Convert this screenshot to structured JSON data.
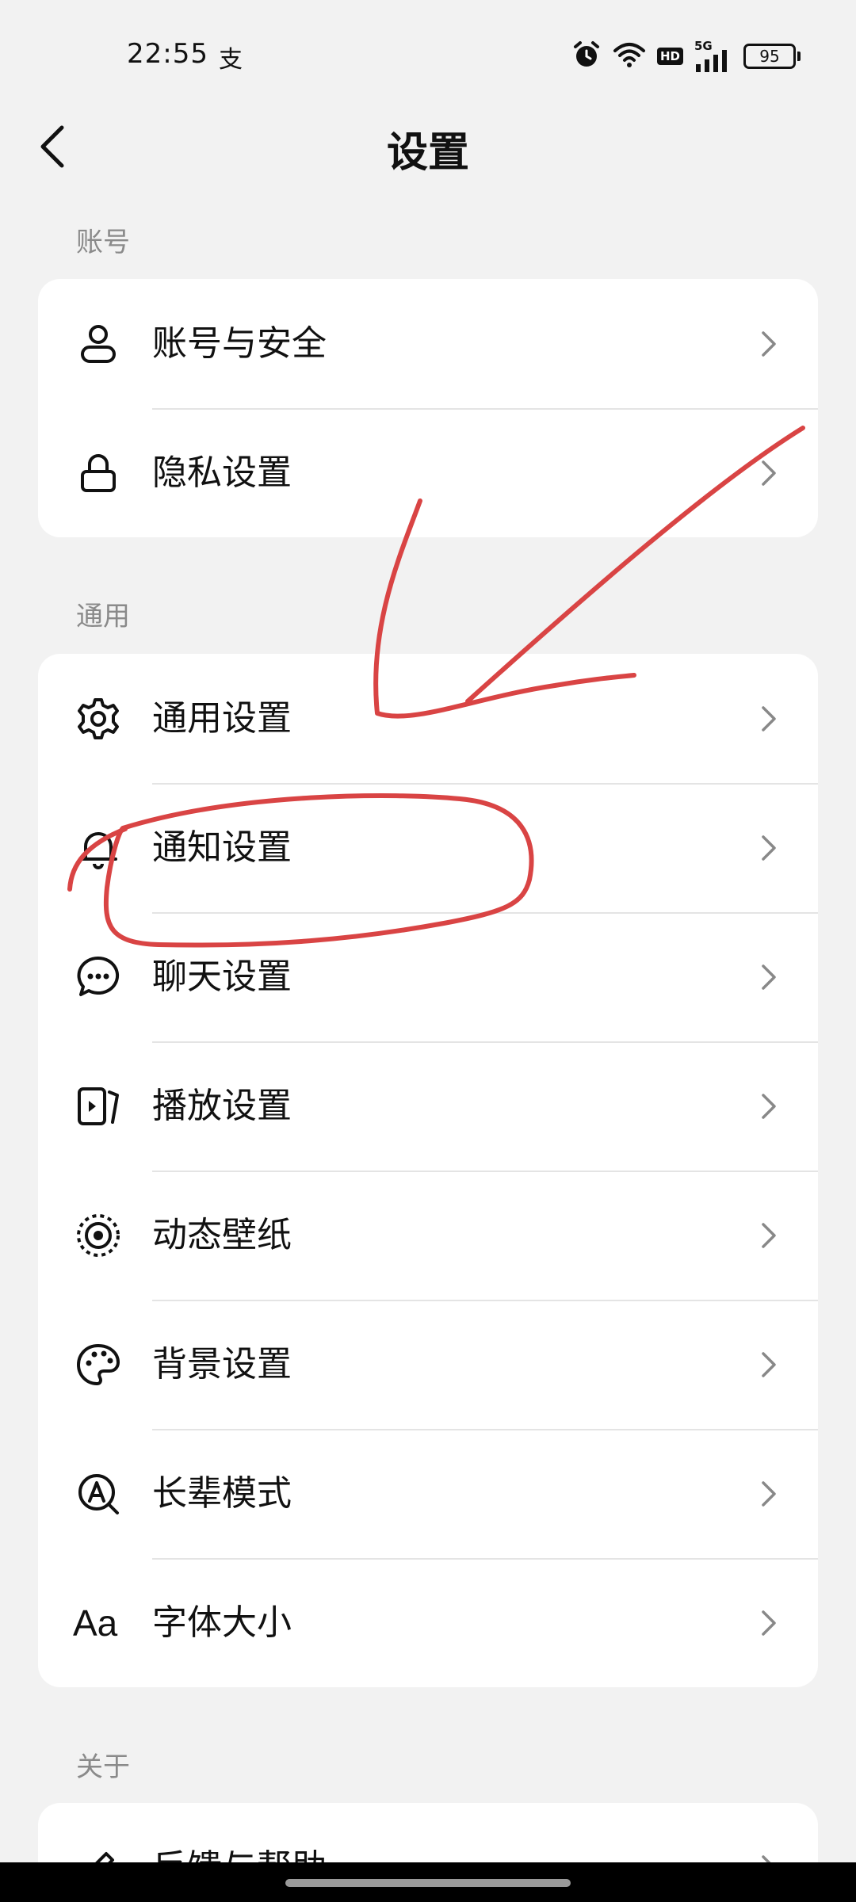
{
  "status_bar": {
    "time": "22:55",
    "notification_glyph": "支",
    "icons": [
      "alarm-icon",
      "wifi-icon",
      "hd-icon",
      "signal-5g-icon",
      "battery-icon"
    ],
    "hd_label": "HD",
    "network_label": "5G",
    "battery": "95"
  },
  "header": {
    "title": "设置",
    "back_icon": "chevron-left-icon"
  },
  "sections": [
    {
      "label": "账号",
      "items": [
        {
          "label": "账号与安全",
          "icon": "person-icon"
        },
        {
          "label": "隐私设置",
          "icon": "lock-icon"
        }
      ]
    },
    {
      "label": "通用",
      "items": [
        {
          "label": "通用设置",
          "icon": "gear-icon"
        },
        {
          "label": "通知设置",
          "icon": "bell-icon"
        },
        {
          "label": "聊天设置",
          "icon": "chat-bubble-icon"
        },
        {
          "label": "播放设置",
          "icon": "play-screen-icon"
        },
        {
          "label": "动态壁纸",
          "icon": "dynamic-wallpaper-icon"
        },
        {
          "label": "背景设置",
          "icon": "palette-icon"
        },
        {
          "label": "长辈模式",
          "icon": "elder-mode-icon"
        },
        {
          "label": "字体大小",
          "icon": "font-size-icon",
          "icon_text": "Aa"
        }
      ]
    },
    {
      "label": "关于",
      "items": [
        {
          "label": "反馈与帮助",
          "icon": "pencil-icon"
        }
      ]
    }
  ],
  "colors": {
    "background": "#f2f2f2",
    "card": "#ffffff",
    "annotation": "#d94444",
    "section_label": "#8a8a8a"
  }
}
